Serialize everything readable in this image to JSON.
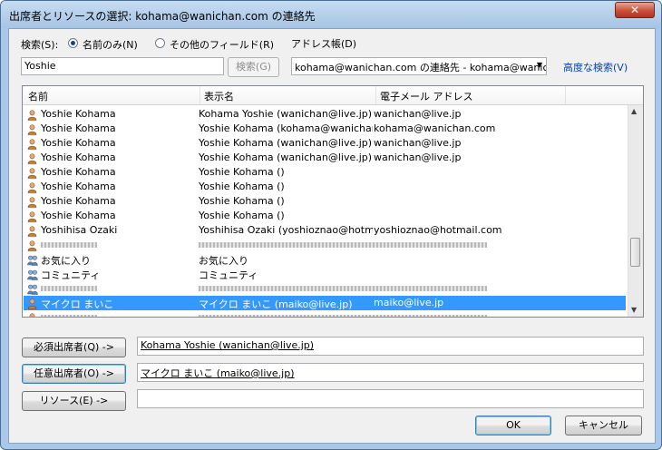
{
  "window": {
    "title": "出席者とリソースの選択: kohama@wanichan.com の連絡先",
    "close_label": "✕"
  },
  "search": {
    "label": "検索(S):",
    "radio_name_only": "名前のみ(N)",
    "radio_other_fields": "その他のフィールド(R)",
    "query": "Yoshie",
    "button": "検索(G)"
  },
  "address_book": {
    "label": "アドレス帳(D)",
    "selected": "kohama@wanichan.com の連絡先 - kohama@wanic",
    "advanced_search": "高度な検索(V)"
  },
  "columns": {
    "name": "名前",
    "display_name": "表示名",
    "email": "電子メール アドレス"
  },
  "rows": [
    {
      "icon": "contact-icon",
      "name": "Yoshie Kohama",
      "display": "Kohama Yoshie (wanichan@live.jp)",
      "email": "wanichan@live.jp"
    },
    {
      "icon": "contact-icon",
      "name": "Yoshie Kohama",
      "display": "Yoshie Kohama (kohama@wanichan...",
      "email": "kohama@wanichan.com"
    },
    {
      "icon": "contact-icon",
      "name": "Yoshie Kohama",
      "display": "Yoshie Kohama (wanichan@live.jp)",
      "email": "wanichan@live.jp"
    },
    {
      "icon": "contact-icon",
      "name": "Yoshie Kohama",
      "display": "Yoshie Kohama (wanichan@live.jp)",
      "email": "wanichan@live.jp"
    },
    {
      "icon": "contact-icon",
      "name": "Yoshie Kohama",
      "display": "Yoshie Kohama ()",
      "email": ""
    },
    {
      "icon": "contact-icon",
      "name": "Yoshie Kohama",
      "display": "Yoshie Kohama ()",
      "email": ""
    },
    {
      "icon": "contact-icon",
      "name": "Yoshie Kohama",
      "display": "Yoshie Kohama ()",
      "email": ""
    },
    {
      "icon": "contact-icon",
      "name": "Yoshie Kohama",
      "display": "Yoshie Kohama ()",
      "email": ""
    },
    {
      "icon": "contact-icon",
      "name": "Yoshihisa Ozaki",
      "display": "Yoshihisa Ozaki (yoshioznao@hotm...",
      "email": "yoshioznao@hotmail.com"
    },
    {
      "icon": "contact-icon",
      "name": "",
      "display": "",
      "email": "",
      "obscured": true
    },
    {
      "icon": "group-icon",
      "name": "お気に入り",
      "display": "お気に入り",
      "email": ""
    },
    {
      "icon": "group-icon",
      "name": "コミュニティ",
      "display": "コミュニティ",
      "email": ""
    },
    {
      "icon": "group-icon",
      "name": "",
      "display": "",
      "email": "",
      "obscured": true
    },
    {
      "icon": "contact-icon",
      "name": "マイクロ まいこ",
      "display": "マイクロ まいこ (maiko@live.jp)",
      "email": "maiko@live.jp",
      "selected": true
    },
    {
      "icon": "contact-icon",
      "name": "",
      "display": "",
      "email": "",
      "obscured": true
    }
  ],
  "attendees": {
    "required_button": "必須出席者(Q) ->",
    "required_value": "Kohama Yoshie (wanichan@live.jp)",
    "optional_button": "任意出席者(O) ->",
    "optional_value": "マイクロ まいこ (maiko@live.jp)",
    "resources_button": "リソース(E) ->",
    "resources_value": ""
  },
  "footer": {
    "ok": "OK",
    "cancel": "キャンセル"
  },
  "colors": {
    "selection": "#3399ff",
    "link": "#0645ad"
  }
}
